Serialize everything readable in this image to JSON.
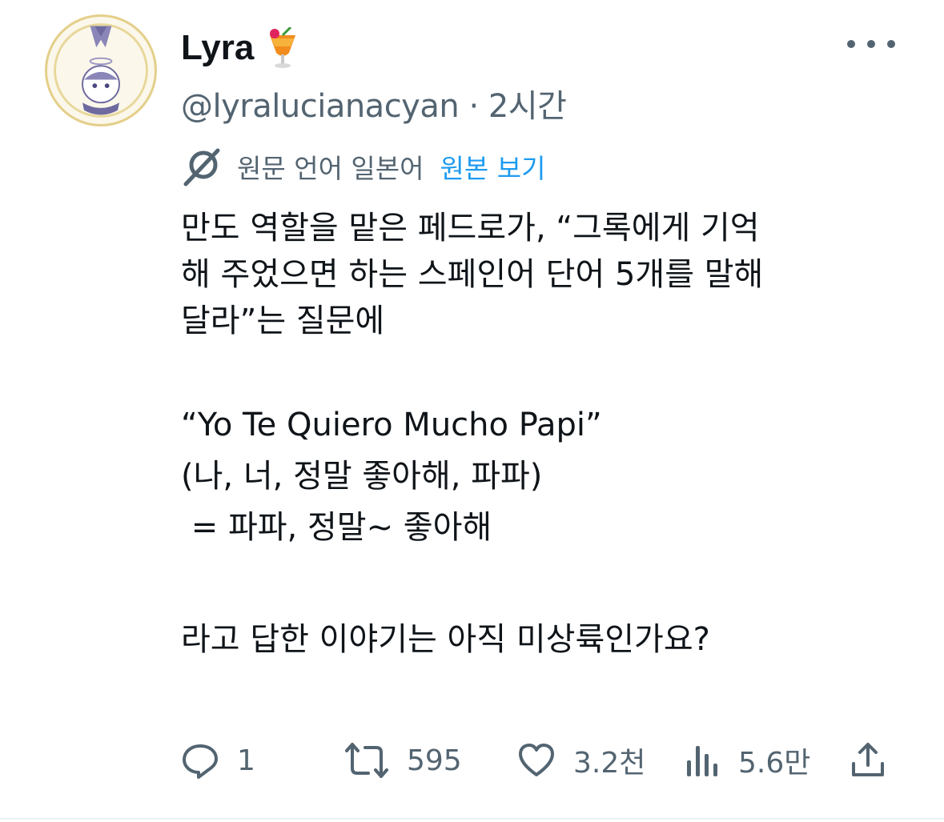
{
  "author": {
    "display_name": "Lyra",
    "emoji_icon": "tropical-drink-icon",
    "handle": "@lyralucianacyan",
    "separator": "·",
    "time": "2시간"
  },
  "translation": {
    "source_language_label": "원문 언어 일본어",
    "show_original_label": "원본 보기"
  },
  "tweet": {
    "lines": [
      "만도 역할을 맡은 페드로가, “그록에게 기억",
      "해 주었으면 하는 스페인어 단어 5개를 말해",
      "달라”는 질문에",
      "",
      "“Yo Te Quiero Mucho Papi”",
      "(나, 너, 정말 좋아해, 파파)",
      " = 파파, 정말~ 좋아해",
      "",
      "라고 답한 이야기는 아직 미상륙인가요?"
    ]
  },
  "actions": {
    "reply_count": "1",
    "retweet_count": "595",
    "like_count": "3.2천",
    "views_count": "5.6만"
  },
  "colors": {
    "text": "#0f1419",
    "secondary": "#536471",
    "link": "#1d9bf0"
  }
}
